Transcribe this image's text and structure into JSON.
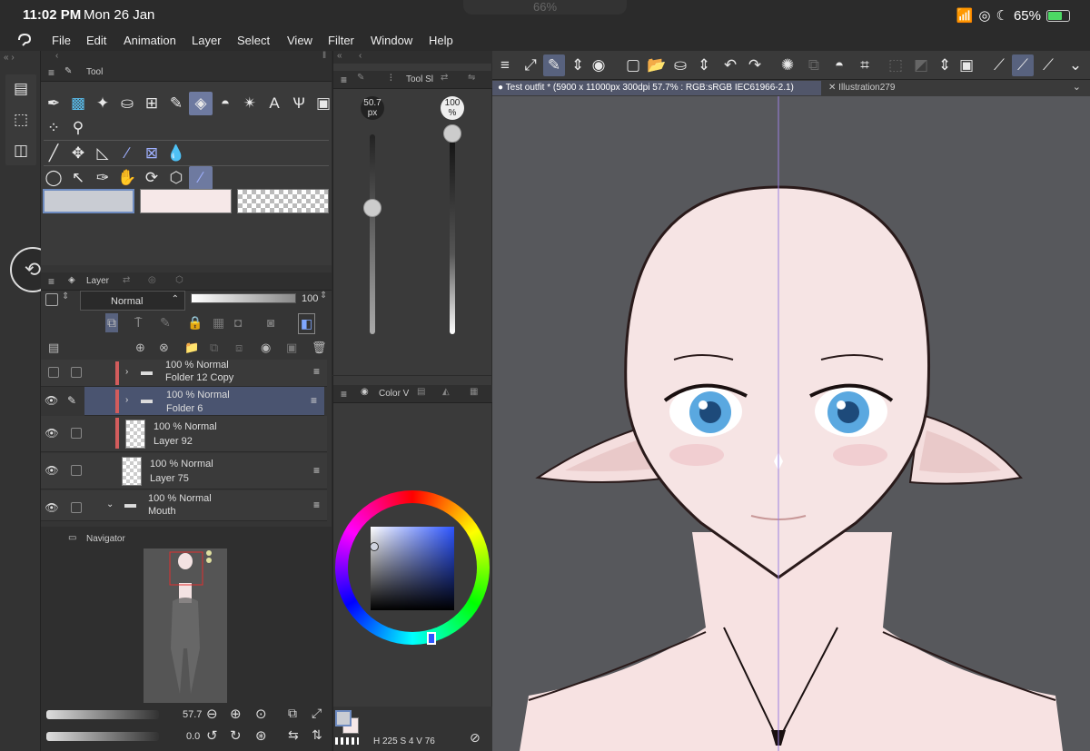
{
  "status": {
    "time": "11:02 PM",
    "date": "Mon 26 Jan",
    "center": "66%",
    "battery": "65%"
  },
  "menu": [
    "File",
    "Edit",
    "Animation",
    "Layer",
    "Select",
    "View",
    "Filter",
    "Window",
    "Help"
  ],
  "tool_panel": {
    "title": "Tool"
  },
  "tool_settings": {
    "title": "Tool Sl",
    "size_value": "50.7",
    "size_unit": "px",
    "opacity_value": "100",
    "opacity_unit": "%"
  },
  "layer_panel": {
    "title": "Layer",
    "blend_mode": "Normal",
    "opacity": "100",
    "layers": [
      {
        "mode": "100 %  Normal",
        "name": "Folder 12 Copy"
      },
      {
        "mode": "100 %  Normal",
        "name": "Folder 6"
      },
      {
        "mode": "100 %  Normal",
        "name": "Layer 92"
      },
      {
        "mode": "100 %  Normal",
        "name": "Layer 75"
      },
      {
        "mode": "100 %  Normal",
        "name": "Mouth"
      }
    ]
  },
  "color_panel": {
    "title": "Color V",
    "h": "225",
    "s": "4",
    "v": "76"
  },
  "navigator": {
    "title": "Navigator",
    "zoom": "57.7",
    "rotation": "0.0"
  },
  "tabs": [
    {
      "label": "Test outfit * (5900 x 11000px 300dpi 57.7% : RGB:sRGB IEC61966-2.1)"
    },
    {
      "label": "Illustration279"
    }
  ],
  "colors": {
    "accent": "#6e7aa0",
    "skin": "#f6e3e3",
    "canvas_bg": "#57585c"
  }
}
